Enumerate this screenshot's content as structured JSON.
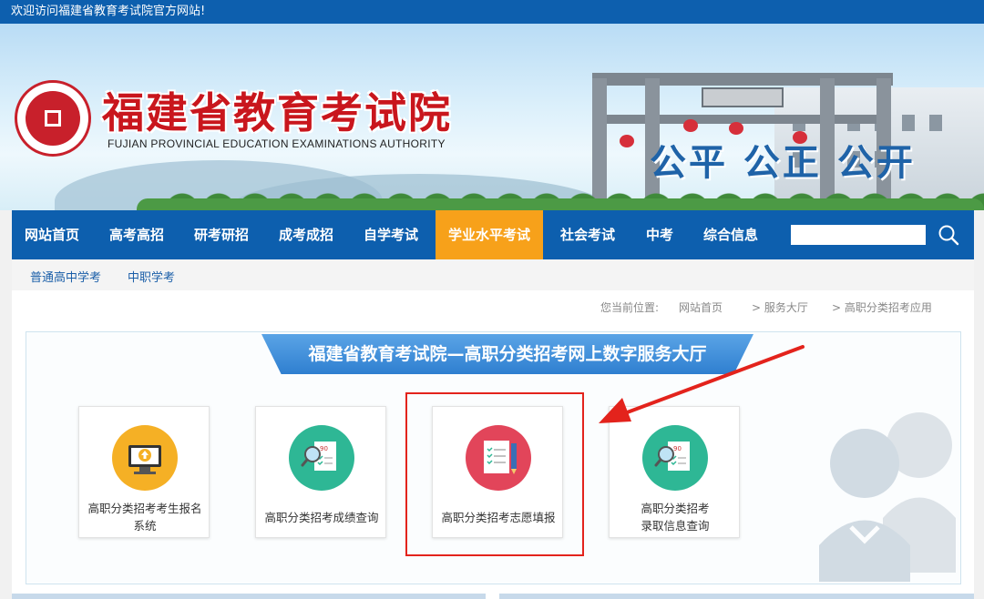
{
  "topbar": {
    "welcome": "欢迎访问福建省教育考试院官方网站!"
  },
  "header": {
    "title": "福建省教育考试院",
    "subtitle": "FUJIAN PROVINCIAL EDUCATION EXAMINATIONS AUTHORITY",
    "slogan": "公平 公正 公开"
  },
  "nav": {
    "items": [
      {
        "label": "网站首页"
      },
      {
        "label": "高考高招"
      },
      {
        "label": "研考研招"
      },
      {
        "label": "成考成招"
      },
      {
        "label": "自学考试"
      },
      {
        "label": "学业水平考试",
        "active": true
      },
      {
        "label": "社会考试"
      },
      {
        "label": "中考"
      },
      {
        "label": "综合信息"
      }
    ],
    "search_placeholder": ""
  },
  "subnav": {
    "items": [
      {
        "label": "普通高中学考"
      },
      {
        "label": "中职学考"
      }
    ]
  },
  "breadcrumb": {
    "prefix": "您当前位置:",
    "items": [
      "网站首页",
      "> 服务大厅",
      "> 高职分类招考应用"
    ]
  },
  "hall": {
    "title": "福建省教育考试院—高职分类招考网上数字服务大厅",
    "cards": [
      {
        "label_line1": "高职分类招考考生报名",
        "label_line2": "系统",
        "icon": "computer-upload-icon",
        "color": "#f5b025"
      },
      {
        "label_line1": "高职分类招考成绩查询",
        "label_line2": "",
        "icon": "score-search-icon",
        "color": "#2eb795"
      },
      {
        "label_line1": "高职分类招考志愿填报",
        "label_line2": "",
        "icon": "form-pencil-icon",
        "color": "#e2455a",
        "highlighted": true
      },
      {
        "label_line1": "高职分类招考",
        "label_line2": "录取信息查询",
        "icon": "admission-search-icon",
        "color": "#2eb795"
      }
    ]
  },
  "colors": {
    "nav_bg": "#0d5fae",
    "nav_active": "#f7a11a",
    "title_red": "#c9161d",
    "highlight_red": "#e3231c"
  }
}
